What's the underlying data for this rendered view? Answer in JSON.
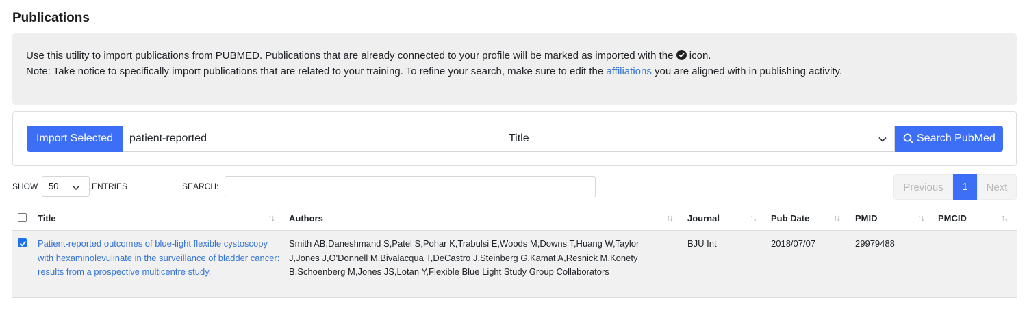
{
  "page": {
    "title": "Publications"
  },
  "info": {
    "line1_before": "Use this utility to import publications from PUBMED. Publications that are already connected to your profile will be marked as imported with the",
    "line1_after": "icon.",
    "line2_before": "Note: Take notice to specifically import publications that are related to your training. To refine your search, make sure to edit the",
    "line2_link": "affiliations",
    "line2_after": "you are aligned with in publishing activity.",
    "icon": "check-circle-icon"
  },
  "search_bar": {
    "import_label": "Import Selected",
    "query_value": "patient-reported",
    "field_selected": "Title",
    "search_label": "Search PubMed"
  },
  "table_controls": {
    "show_label": "SHOW",
    "page_length": "50",
    "entries_label": "ENTRIES",
    "search_label": "SEARCH:",
    "search_value": ""
  },
  "pagination": {
    "prev": "Previous",
    "current": "1",
    "next": "Next"
  },
  "table": {
    "columns": [
      "Title",
      "Authors",
      "Journal",
      "Pub Date",
      "PMID",
      "PMCID"
    ],
    "rows": [
      {
        "checked": true,
        "title": "Patient-reported outcomes of blue-light flexible cystoscopy with hexaminolevulinate in the surveillance of bladder cancer: results from a prospective multicentre study.",
        "authors": "Smith AB,Daneshmand S,Patel S,Pohar K,Trabulsi E,Woods M,Downs T,Huang W,Taylor J,Jones J,O'Donnell M,Bivalacqua T,DeCastro J,Steinberg G,Kamat A,Resnick M,Konety B,Schoenberg M,Jones JS,Lotan Y,Flexible Blue Light Study Group Collaborators",
        "journal": "BJU Int",
        "pub_date": "2018/07/07",
        "pmid": "29979488",
        "pmcid": ""
      }
    ]
  },
  "colors": {
    "primary": "#3d6ff6",
    "link": "#3574d4",
    "info_bg": "#efefef",
    "row_bg": "#f1f1f1"
  }
}
